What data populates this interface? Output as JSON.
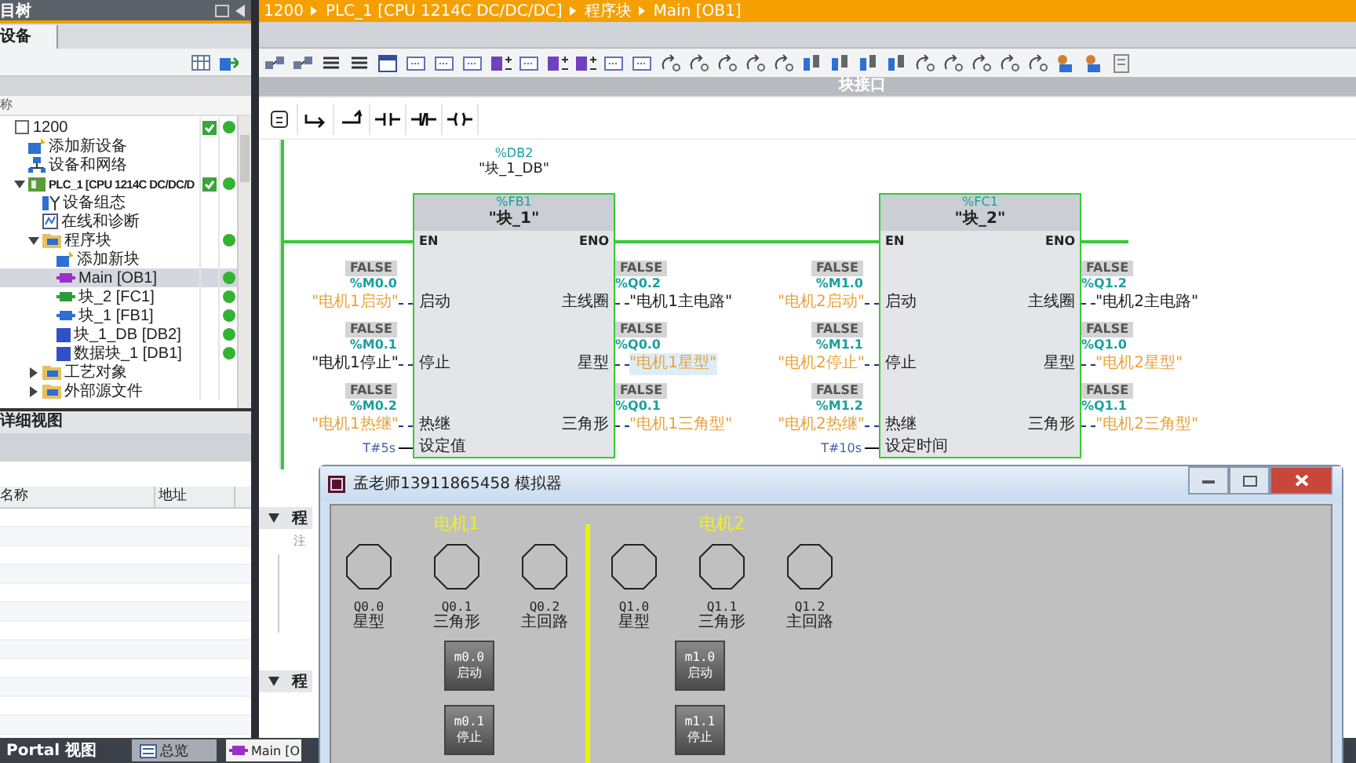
{
  "project_tree": {
    "title": "目树",
    "tab": "设备",
    "column_header": "称",
    "items": [
      {
        "label": "1200",
        "kind": "project",
        "selected": false,
        "consistent": true,
        "ok": true,
        "children": [
          {
            "label": "添加新设备",
            "kind": "add",
            "selected": false,
            "consistent": false,
            "ok": false
          },
          {
            "label": "设备和网络",
            "kind": "network",
            "selected": false,
            "consistent": false,
            "ok": false
          },
          {
            "label": "PLC_1 [CPU 1214C DC/DC/D",
            "kind": "plc",
            "selected": false,
            "consistent": true,
            "ok": true,
            "expanded": true,
            "children": [
              {
                "label": "设备组态",
                "kind": "config",
                "selected": false,
                "consistent": false,
                "ok": false
              },
              {
                "label": "在线和诊断",
                "kind": "diag",
                "selected": false,
                "consistent": false,
                "ok": false
              },
              {
                "label": "程序块",
                "kind": "folder",
                "selected": false,
                "consistent": false,
                "ok": true,
                "expanded": true,
                "children": [
                  {
                    "label": "添加新块",
                    "kind": "add",
                    "selected": false,
                    "consistent": false,
                    "ok": false
                  },
                  {
                    "label": "Main [OB1]",
                    "kind": "block",
                    "color": "#9b30c8",
                    "selected": true,
                    "consistent": false,
                    "ok": true
                  },
                  {
                    "label": "块_2 [FC1]",
                    "kind": "block",
                    "color": "#2e9b3a",
                    "selected": false,
                    "consistent": false,
                    "ok": true
                  },
                  {
                    "label": "块_1 [FB1]",
                    "kind": "block",
                    "color": "#2d6fd4",
                    "selected": false,
                    "consistent": false,
                    "ok": true
                  },
                  {
                    "label": "块_1_DB [DB2]",
                    "kind": "db",
                    "color": "#3050c8",
                    "selected": false,
                    "consistent": false,
                    "ok": true
                  },
                  {
                    "label": "数据块_1 [DB1]",
                    "kind": "db",
                    "color": "#3050c8",
                    "selected": false,
                    "consistent": false,
                    "ok": true
                  }
                ]
              },
              {
                "label": "工艺对象",
                "kind": "folder",
                "selected": false,
                "consistent": false,
                "ok": false,
                "expanded": false
              },
              {
                "label": "外部源文件",
                "kind": "folder",
                "selected": false,
                "consistent": false,
                "ok": false,
                "expanded": false
              }
            ]
          }
        ]
      }
    ]
  },
  "details_view": {
    "title": "详细视图",
    "columns": [
      "名称",
      "地址"
    ]
  },
  "taskbar": {
    "portal": "Portal 视图",
    "tabs": [
      {
        "label": "总览",
        "selected": false
      },
      {
        "label": "Main [O",
        "selected": true
      }
    ]
  },
  "editor": {
    "breadcrumb": [
      "1200",
      "PLC_1 [CPU 1214C DC/DC/DC]",
      "程序块",
      "Main [OB1]"
    ],
    "interface_bar": "块接口",
    "blocks": [
      {
        "db_address": "%DB2",
        "db_name": "\"块_1_DB\"",
        "address": "%FB1",
        "name": "\"块_1\"",
        "en": "EN",
        "eno": "ENO",
        "inputs": [
          {
            "value": "FALSE",
            "address": "%M0.0",
            "tag": "\"电机1启动\"",
            "pin": "启动",
            "color": "#e8a33c"
          },
          {
            "value": "FALSE",
            "address": "%M0.1",
            "tag": "\"电机1停止\"",
            "pin": "停止",
            "color": "#222222"
          },
          {
            "value": "FALSE",
            "address": "%M0.2",
            "tag": "\"电机1热继\"",
            "pin": "热继",
            "color": "#e8a33c"
          }
        ],
        "outputs": [
          {
            "value": "FALSE",
            "address": "%Q0.2",
            "tag": "\"电机1主电路\"",
            "pin": "主线圈",
            "color": "#222222",
            "selected": false
          },
          {
            "value": "FALSE",
            "address": "%Q0.0",
            "tag": "\"电机1星型\"",
            "pin": "星型",
            "color": "#e8a33c",
            "selected": true
          },
          {
            "value": "FALSE",
            "address": "%Q0.1",
            "tag": "\"电机1三角型\"",
            "pin": "三角形",
            "color": "#e8a33c",
            "selected": false
          }
        ],
        "parameter": {
          "value": "T#5s",
          "pin": "设定值"
        }
      },
      {
        "address": "%FC1",
        "name": "\"块_2\"",
        "en": "EN",
        "eno": "ENO",
        "inputs": [
          {
            "value": "FALSE",
            "address": "%M1.0",
            "tag": "\"电机2启动\"",
            "pin": "启动",
            "color": "#e8a33c"
          },
          {
            "value": "FALSE",
            "address": "%M1.1",
            "tag": "\"电机2停止\"",
            "pin": "停止",
            "color": "#e8a33c"
          },
          {
            "value": "FALSE",
            "address": "%M1.2",
            "tag": "\"电机2热继\"",
            "pin": "热继",
            "color": "#e8a33c"
          }
        ],
        "outputs": [
          {
            "value": "FALSE",
            "address": "%Q1.2",
            "tag": "\"电机2主电路\"",
            "pin": "主线圈",
            "color": "#222222",
            "selected": false
          },
          {
            "value": "FALSE",
            "address": "%Q1.0",
            "tag": "\"电机2星型\"",
            "pin": "星型",
            "color": "#e8a33c",
            "selected": false
          },
          {
            "value": "FALSE",
            "address": "%Q1.1",
            "tag": "\"电机2三角型\"",
            "pin": "三角形",
            "color": "#e8a33c",
            "selected": false
          }
        ],
        "parameter": {
          "value": "T#10s",
          "pin": "设定时间"
        }
      }
    ],
    "networks": [
      {
        "title": "程",
        "comment": "注"
      },
      {
        "title": "程"
      }
    ]
  },
  "simulator": {
    "title": "孟老师13911865458 模拟器",
    "groups": [
      {
        "title": "电机1",
        "lamps": [
          {
            "address": "Q0.0",
            "label": "星型",
            "on": false
          },
          {
            "address": "Q0.1",
            "label": "三角形",
            "on": false
          },
          {
            "address": "Q0.2",
            "label": "主回路",
            "on": false
          }
        ],
        "buttons": [
          {
            "address": "m0.0",
            "label": "启动"
          },
          {
            "address": "m0.1",
            "label": "停止"
          }
        ]
      },
      {
        "title": "电机2",
        "lamps": [
          {
            "address": "Q1.0",
            "label": "星型",
            "on": false
          },
          {
            "address": "Q1.1",
            "label": "三角形",
            "on": false
          },
          {
            "address": "Q1.2",
            "label": "主回路",
            "on": false
          }
        ],
        "buttons": [
          {
            "address": "m1.0",
            "label": "启动"
          },
          {
            "address": "m1.1",
            "label": "停止"
          }
        ]
      }
    ]
  }
}
